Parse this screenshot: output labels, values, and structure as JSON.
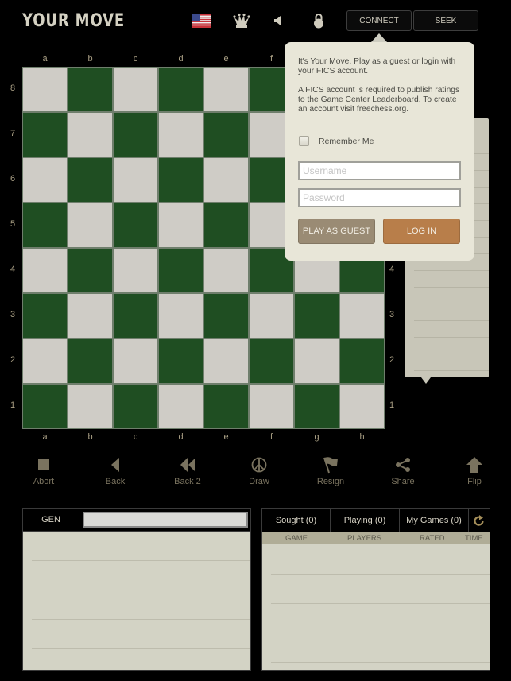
{
  "header": {
    "title": "YOUR MOVE",
    "icons": [
      "us-flag-icon",
      "queen-icon",
      "speaker-icon",
      "lock-icon"
    ],
    "connect_label": "CONNECT",
    "seek_label": "SEEK"
  },
  "board": {
    "files": [
      "a",
      "b",
      "c",
      "d",
      "e",
      "f",
      "g",
      "h"
    ],
    "ranks": [
      "8",
      "7",
      "6",
      "5",
      "4",
      "3",
      "2",
      "1"
    ],
    "light_color": "#cfccc6",
    "dark_color": "#1f4e22"
  },
  "popup": {
    "intro": "It's Your Move. Play as a guest or login with your FICS account.",
    "info": "A FICS account is required to publish ratings to the Game Center Leaderboard.  To create an account visit freechess.org.",
    "remember_label": "Remember Me",
    "remember_checked": false,
    "username_placeholder": "Username",
    "username_value": "",
    "password_placeholder": "Password",
    "password_value": "",
    "guest_label": "PLAY AS GUEST",
    "login_label": "LOG IN",
    "guest_color": "#9a8b74",
    "login_color": "#b87e4a"
  },
  "toolbar": {
    "items": [
      {
        "label": "Abort",
        "icon": "stop-icon"
      },
      {
        "label": "Back",
        "icon": "back-icon"
      },
      {
        "label": "Back 2",
        "icon": "back-two-icon"
      },
      {
        "label": "Draw",
        "icon": "peace-icon"
      },
      {
        "label": "Resign",
        "icon": "flag-icon"
      },
      {
        "label": "Share",
        "icon": "share-icon"
      },
      {
        "label": "Flip",
        "icon": "flip-arrow-icon"
      }
    ]
  },
  "chat": {
    "channel_label": "GEN",
    "input_value": ""
  },
  "games": {
    "tabs": [
      "Sought (0)",
      "Playing (0)",
      "My Games (0)"
    ],
    "refresh_icon": "refresh-icon",
    "columns": [
      "GAME",
      "PLAYERS",
      "RATED",
      "TIME"
    ],
    "rows": []
  }
}
